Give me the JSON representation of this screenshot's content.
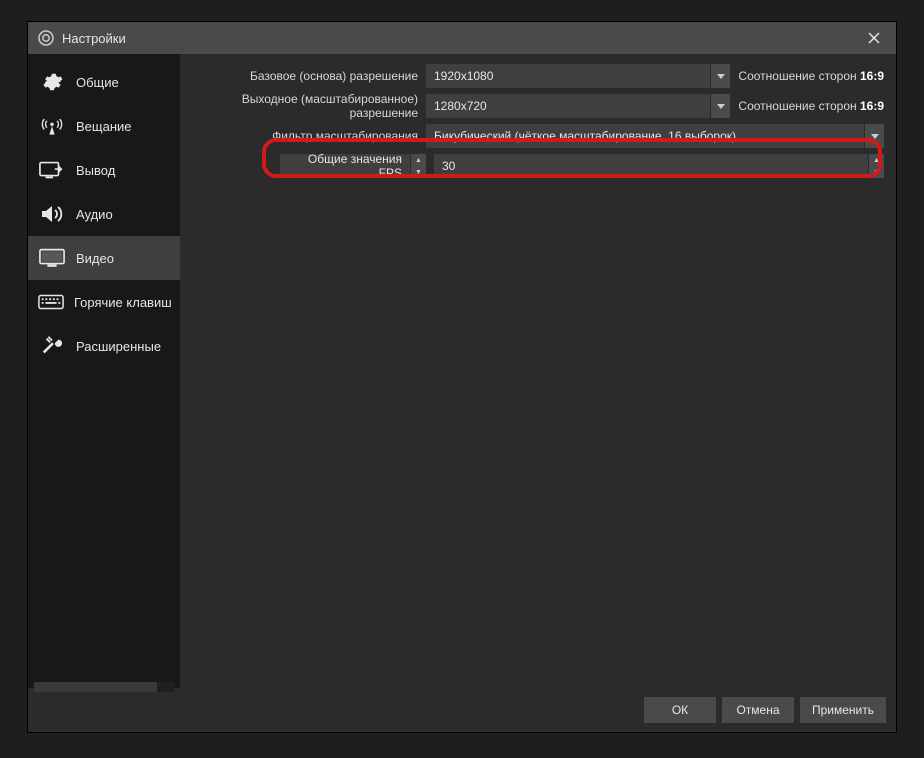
{
  "window": {
    "title": "Настройки"
  },
  "sidebar": {
    "items": [
      {
        "id": "general",
        "label": "Общие"
      },
      {
        "id": "stream",
        "label": "Вещание"
      },
      {
        "id": "output",
        "label": "Вывод"
      },
      {
        "id": "audio",
        "label": "Аудио"
      },
      {
        "id": "video",
        "label": "Видео"
      },
      {
        "id": "hotkeys",
        "label": "Горячие клавиш"
      },
      {
        "id": "advanced",
        "label": "Расширенные"
      }
    ],
    "selected": "video"
  },
  "video": {
    "base_resolution": {
      "label": "Базовое (основа) разрешение",
      "value": "1920x1080"
    },
    "output_resolution": {
      "label": "Выходное (масштабированное) разрешение",
      "value": "1280x720"
    },
    "ratio": {
      "label": "Соотношение сторон",
      "value": "16:9"
    },
    "downscale_filter": {
      "label": "Фильтр масштабирования",
      "value": "Бикубический (чёткое масштабирование, 16 выборок)"
    },
    "fps_type": {
      "label": "Общие значения FPS"
    },
    "fps_value": {
      "value": "30"
    }
  },
  "footer": {
    "ok": "ОК",
    "cancel": "Отмена",
    "apply": "Применить"
  }
}
